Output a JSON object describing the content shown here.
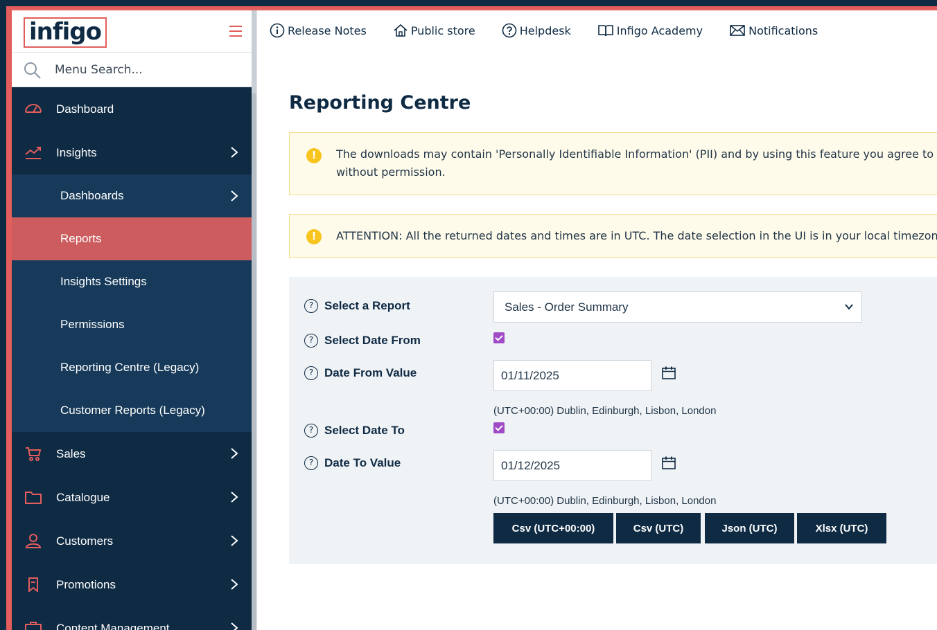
{
  "brand": {
    "logo_text": "infigo",
    "accent": "#e35d5d",
    "navy": "#0f2b44"
  },
  "sidebar": {
    "search_placeholder": "Menu Search...",
    "items": [
      {
        "label": "Dashboard",
        "icon": "dashboard-gauge-icon"
      },
      {
        "label": "Insights",
        "icon": "chart-trend-icon"
      },
      {
        "label": "Dashboards"
      },
      {
        "label": "Reports"
      },
      {
        "label": "Insights Settings"
      },
      {
        "label": "Permissions"
      },
      {
        "label": "Reporting Centre (Legacy)"
      },
      {
        "label": "Customer Reports (Legacy)"
      },
      {
        "label": "Sales",
        "icon": "cart-icon"
      },
      {
        "label": "Catalogue",
        "icon": "folder-icon"
      },
      {
        "label": "Customers",
        "icon": "user-icon"
      },
      {
        "label": "Promotions",
        "icon": "bookmark-icon"
      },
      {
        "label": "Content Management",
        "icon": "briefcase-icon"
      }
    ]
  },
  "topnav": {
    "release_notes": "Release Notes",
    "public_store": "Public store",
    "helpdesk": "Helpdesk",
    "academy": "Infigo Academy",
    "notifications": "Notifications"
  },
  "main": {
    "title": "Reporting Centre",
    "alert_pii_line1": "The downloads may contain 'Personally Identifiable Information' (PII) and by using this feature you agree to treat th",
    "alert_pii_line2": "without permission.",
    "alert_utc": "ATTENTION: All the returned dates and times are in UTC. The date selection in the UI is in your local timezone - (UT",
    "form": {
      "select_report_label": "Select a Report",
      "select_report_value": "Sales - Order Summary",
      "select_date_from_label": "Select Date From",
      "select_date_from_checked": true,
      "date_from_label": "Date From Value",
      "date_from_value": "01/11/2025",
      "timezone_note_from": "(UTC+00:00) Dublin, Edinburgh, Lisbon, London",
      "select_date_to_label": "Select Date To",
      "select_date_to_checked": true,
      "date_to_label": "Date To Value",
      "date_to_value": "01/12/2025",
      "timezone_note_to": "(UTC+00:00) Dublin, Edinburgh, Lisbon, London"
    },
    "buttons": {
      "csv_local": "Csv (UTC+00:00)",
      "csv_utc": "Csv (UTC)",
      "json_utc": "Json (UTC)",
      "xlsx_utc": "Xlsx (UTC)"
    }
  }
}
